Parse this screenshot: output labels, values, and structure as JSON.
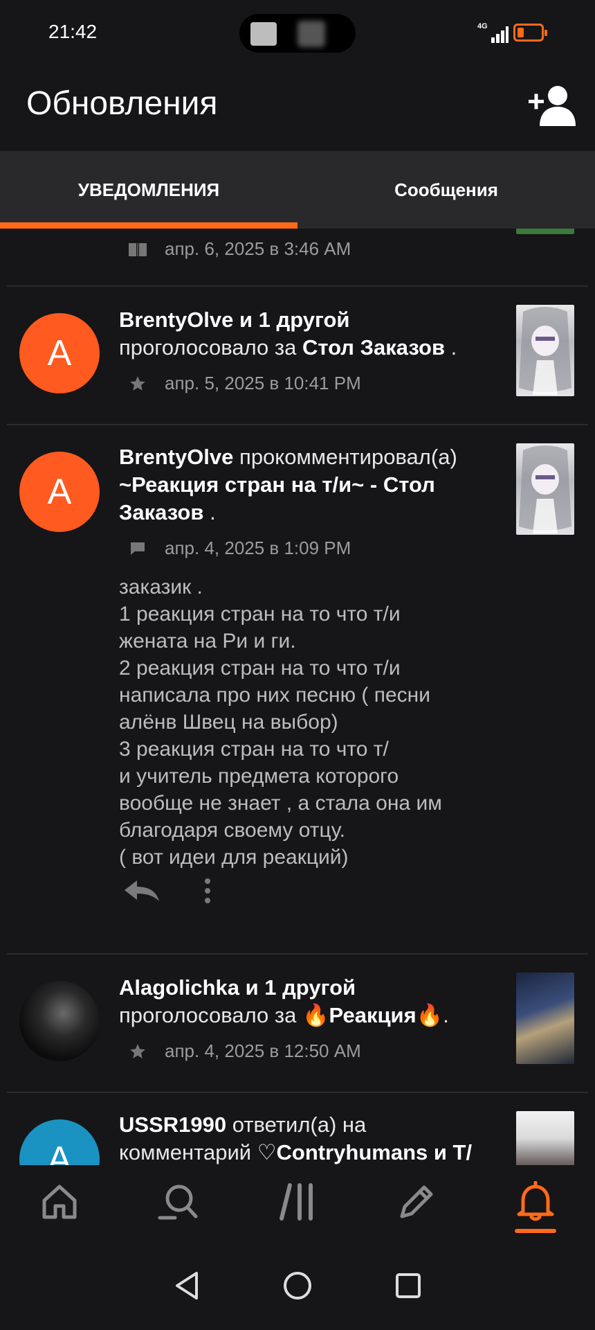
{
  "status_bar": {
    "time": "21:42",
    "network": "4G"
  },
  "header": {
    "title": "Обновления",
    "add_user_icon": "add-user-icon"
  },
  "tabs": [
    {
      "label": "УВЕДОМЛЕНИЯ",
      "active": true
    },
    {
      "label": "Сообщения",
      "active": false
    }
  ],
  "feed": {
    "top_partial": {
      "date": "апр. 6, 2025 в 3:46 AM",
      "icon": "book-icon"
    },
    "items": [
      {
        "avatar_letter": "A",
        "actor": "BrentyOlve и 1 другой",
        "action": "проголосовало за",
        "target": "Стол Заказов",
        "suffix": ".",
        "date": "апр. 5, 2025 в 10:41 PM",
        "icon": "star-icon"
      },
      {
        "avatar_letter": "A",
        "actor": "BrentyOlve",
        "action": "прокомментировал(а)",
        "target": "~Реакция стран на т/и~ - Стол Заказов",
        "suffix": ".",
        "date": "апр. 4, 2025 в 1:09 PM",
        "icon": "comment-icon",
        "comment": "заказик .\n1 реакция стран на то что т/и\nжената на Ри и ги.\n2 реакция стран на то что т/и\nнаписала про них песню ( песни\nалёнв Швец на выбор)\n3 реакция стран на то что т/\nи учитель предмета которого\nвообще не знает , а стала она им\nблагодаря своему отцу.\n( вот идеи для реакций)"
      },
      {
        "avatar_letter": "",
        "actor": "Alagolichka и 1 другой",
        "action": "проголосовало за",
        "target": "🔥Реакция🔥",
        "suffix": ".",
        "date": "апр. 4, 2025 в 12:50 AM",
        "icon": "star-icon"
      },
      {
        "avatar_letter": "A",
        "actor": "USSR1990",
        "action": "ответил(а) на",
        "action2": "комментарий",
        "target": "♡Contryhumans и Т/",
        "suffix": ""
      }
    ]
  },
  "bottom_nav": [
    "home-icon",
    "search-icon",
    "library-icon",
    "write-icon",
    "notifications-icon"
  ],
  "colors": {
    "accent": "#ff6a1a",
    "avatar_orange": "#ff5a1f",
    "avatar_blue": "#1a93c2",
    "background": "#161517",
    "tabbar": "#29282a"
  }
}
